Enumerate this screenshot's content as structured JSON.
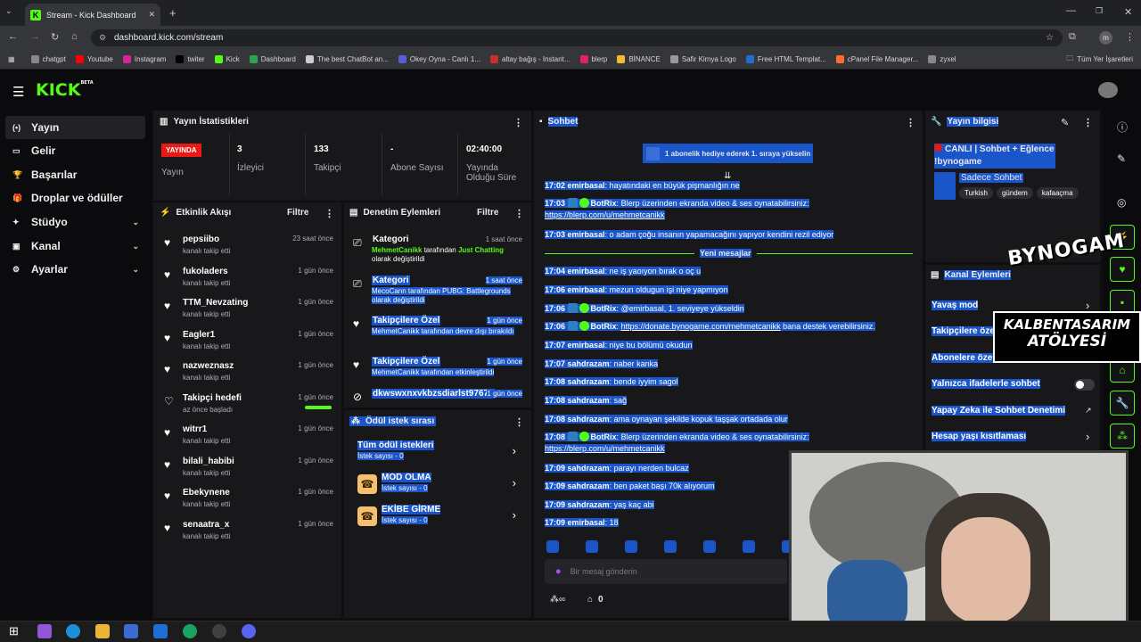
{
  "browser": {
    "tab_title": "Stream - Kick Dashboard",
    "url": "dashboard.kick.com/stream",
    "profile_initial": "m",
    "bookmarks": [
      "chatgpt",
      "Youtube",
      "Instagram",
      "twiter",
      "Kick",
      "Dashboard",
      "The best ChatBot an...",
      "Okey Oyna - Canlı 1...",
      "altay bağış - Instant...",
      "blerp",
      "BİNANCE",
      "Safir Kimya Logo",
      "Free HTML Templat...",
      "cPanel File Manager...",
      "zyxel"
    ],
    "bookmarks_all": "Tüm Yer İşaretleri"
  },
  "app": {
    "logo": "KICK",
    "logo_sup": "BETA"
  },
  "sidebar": {
    "items": [
      {
        "label": "Yayın",
        "active": true
      },
      {
        "label": "Gelir"
      },
      {
        "label": "Başarılar"
      },
      {
        "label": "Droplar ve ödüller"
      },
      {
        "label": "Stüdyo",
        "chevron": true
      },
      {
        "label": "Kanal",
        "chevron": true
      },
      {
        "label": "Ayarlar",
        "chevron": true
      }
    ]
  },
  "stats": {
    "title": "Yayın İstatistikleri",
    "live_badge": "YAYINDA",
    "live_label": "Yayın",
    "items": [
      {
        "value": "3",
        "label": "İzleyici"
      },
      {
        "value": "133",
        "label": "Takipçi"
      },
      {
        "value": "-",
        "label": "Abone Sayısı"
      },
      {
        "value": "02:40:00",
        "label": "Yayında Olduğu Süre"
      }
    ]
  },
  "activity": {
    "title": "Etkinlik Akışı",
    "filter": "Filtre",
    "items": [
      {
        "name": "pepsiibo",
        "sub": "kanalı takip etti",
        "time": "23 saat önce"
      },
      {
        "name": "fukoladers",
        "sub": "kanalı takip etti",
        "time": "1 gün önce"
      },
      {
        "name": "TTM_Nevzating",
        "sub": "kanalı takip etti",
        "time": "1 gün önce"
      },
      {
        "name": "Eagler1",
        "sub": "kanalı takip etti",
        "time": "1 gün önce"
      },
      {
        "name": "nazweznasz",
        "sub": "kanalı takip etti",
        "time": "1 gün önce"
      },
      {
        "name": "Takipçi hedefi",
        "sub": "az önce başladı",
        "time": "1 gün önce",
        "goal": true
      },
      {
        "name": "witrr1",
        "sub": "kanalı takip etti",
        "time": "1 gün önce"
      },
      {
        "name": "bilali_habibi",
        "sub": "kanalı takip etti",
        "time": "1 gün önce"
      },
      {
        "name": "Ebekynene",
        "sub": "kanalı takip etti",
        "time": "1 gün önce"
      },
      {
        "name": "senaatra_x",
        "sub": "kanalı takip etti",
        "time": "1 gün önce"
      }
    ]
  },
  "moderation": {
    "title": "Denetim Eylemleri",
    "filter": "Filtre",
    "items": [
      {
        "title": "Kategori",
        "time": "1 saat önce",
        "user": "MehmetCanikk",
        "mid": " tarafından ",
        "hl": "Just Chatting",
        "tail": " olarak değiştirildi"
      },
      {
        "title": "Kategori",
        "time": "1 saat önce",
        "desc": "MecoCann tarafından PUBG: Battlegrounds olarak değiştirildi"
      },
      {
        "title": "Takipçilere Özel",
        "time": "1 gün önce",
        "desc": "MehmetCanikk tarafından devre dışı bırakıldı"
      },
      {
        "title": "Takipçilere Özel",
        "time": "1 gün önce",
        "desc": "MehmetCanikk tarafından etkinleştirildi"
      },
      {
        "title": "dkwswxnxvkbzsdiarlst97671",
        "time": "1 gün önce"
      }
    ]
  },
  "rewards": {
    "title": "Ödül istek sırası",
    "items": [
      {
        "name": "Tüm ödül istekleri",
        "count": "İstek sayısı - 0"
      },
      {
        "name": "MOD OLMA",
        "count": "İstek sayısı - 0"
      },
      {
        "name": "EKİBE GİRME",
        "count": "İstek sayısı - 0"
      }
    ]
  },
  "chat": {
    "title": "Sohbet",
    "pinned": "1 abonelik hediye ederek 1. sıraya yükselin",
    "new_messages": "Yeni mesajlar",
    "input_placeholder": "Bir mesaj gönderin",
    "footer_count": "0",
    "messages": [
      {
        "time": "17:02",
        "user": "emirbasal",
        "text": "hayatındaki en büyük pişmanlığın ne"
      },
      {
        "time": "17:03",
        "user": "BotRix",
        "bot": true,
        "text": "Blerp üzerinden ekranda video & ses oynatabilirsiniz:",
        "link": "https://blerp.com/u/mehmetcanikk"
      },
      {
        "time": "17:03",
        "user": "emirbasal",
        "text": "o adam çoğu insanın yapamacağını yapıyor kendini rezil ediyor"
      },
      {
        "time": "17:04",
        "user": "emirbasal",
        "text": "ne iş yaoıyon bırak o oç u"
      },
      {
        "time": "17:06",
        "user": "emirbasal",
        "text": "mezun oldugun işi niye yapmıyon"
      },
      {
        "time": "17:06",
        "user": "BotRix",
        "bot": true,
        "text": "@emirbasal, 1. seviyeye yükseldin"
      },
      {
        "time": "17:06",
        "user": "BotRix",
        "bot": true,
        "text": "",
        "link": "https://donate.bynogame.com/mehmetcanikk",
        "after": " bana destek verebilirsiniz."
      },
      {
        "time": "17:07",
        "user": "emirbasal",
        "text": "niye bu bölümü okudun"
      },
      {
        "time": "17:07",
        "user": "sahdrazam",
        "text": "naber kanka"
      },
      {
        "time": "17:08",
        "user": "sahdrazam",
        "text": "bende iyyim sagol"
      },
      {
        "time": "17:08",
        "user": "sahdrazam",
        "text": "sağ"
      },
      {
        "time": "17:08",
        "user": "sahdrazam",
        "text": "ama oynayan şekilde kopuk taşşak ortadada olur"
      },
      {
        "time": "17:08",
        "user": "BotRix",
        "bot": true,
        "text": "Blerp üzerinden ekranda video & ses oynatabilirsiniz:",
        "link": "https://blerp.com/u/mehmetcanikk"
      },
      {
        "time": "17:09",
        "user": "sahdrazam",
        "text": "parayı nerden bulcaz"
      },
      {
        "time": "17:09",
        "user": "sahdrazam",
        "text": "ben paket başı 70k alıyorum"
      },
      {
        "time": "17:09",
        "user": "sahdrazam",
        "text": "yaş kaç abi"
      },
      {
        "time": "17:09",
        "user": "emirbasal",
        "text": "18"
      }
    ]
  },
  "stream_info": {
    "title": "Yayın bilgisi",
    "stream_title": "CANLI | Sohbet + Eğlence !bynogame",
    "category": "Sadece Sohbet",
    "tags": [
      "Turkish",
      "gündem",
      "kafaaçma"
    ]
  },
  "channel_actions": {
    "title": "Kanal Eylemleri",
    "items": [
      "Yavaş mod",
      "Takipçilere özel",
      "Abonelere özel",
      "Yalnızca ifadelerle sohbet",
      "Yapay Zeka ile Sohbet Denetimi",
      "Hesap yaşı kısıtlaması"
    ]
  },
  "overlay": {
    "brand1": "BYNOGAM",
    "brand2": "KALBENTASARIM",
    "brand3": "ATÖLYESİ"
  },
  "colors": {
    "accent": "#53fc18",
    "live": "#e91916",
    "selection": "#1a56c9"
  }
}
